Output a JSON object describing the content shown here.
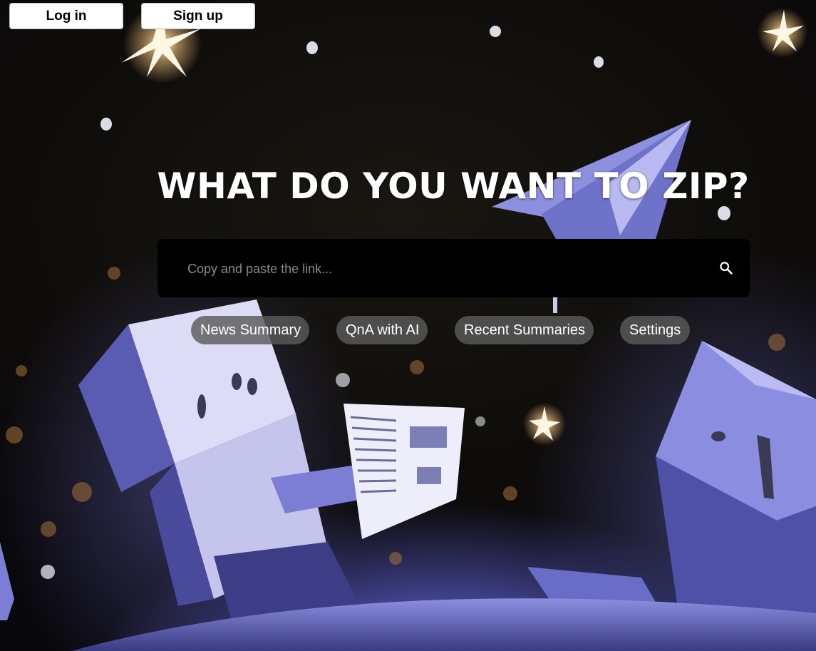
{
  "header": {
    "login_label": "Log in",
    "signup_label": "Sign up"
  },
  "hero": {
    "headline": "WHAT DO YOU WANT TO ZIP?"
  },
  "search": {
    "placeholder": "Copy and paste the link...",
    "value": "",
    "icon": "search-icon"
  },
  "nav": {
    "chips": [
      {
        "label": "News Summary"
      },
      {
        "label": "QnA with AI"
      },
      {
        "label": "Recent Summaries"
      },
      {
        "label": "Settings"
      }
    ]
  },
  "colors": {
    "background": "#0b0a10",
    "search_bar": "#000000",
    "chip": "#5a5a5a",
    "origami_purple": "#6f72c9"
  }
}
